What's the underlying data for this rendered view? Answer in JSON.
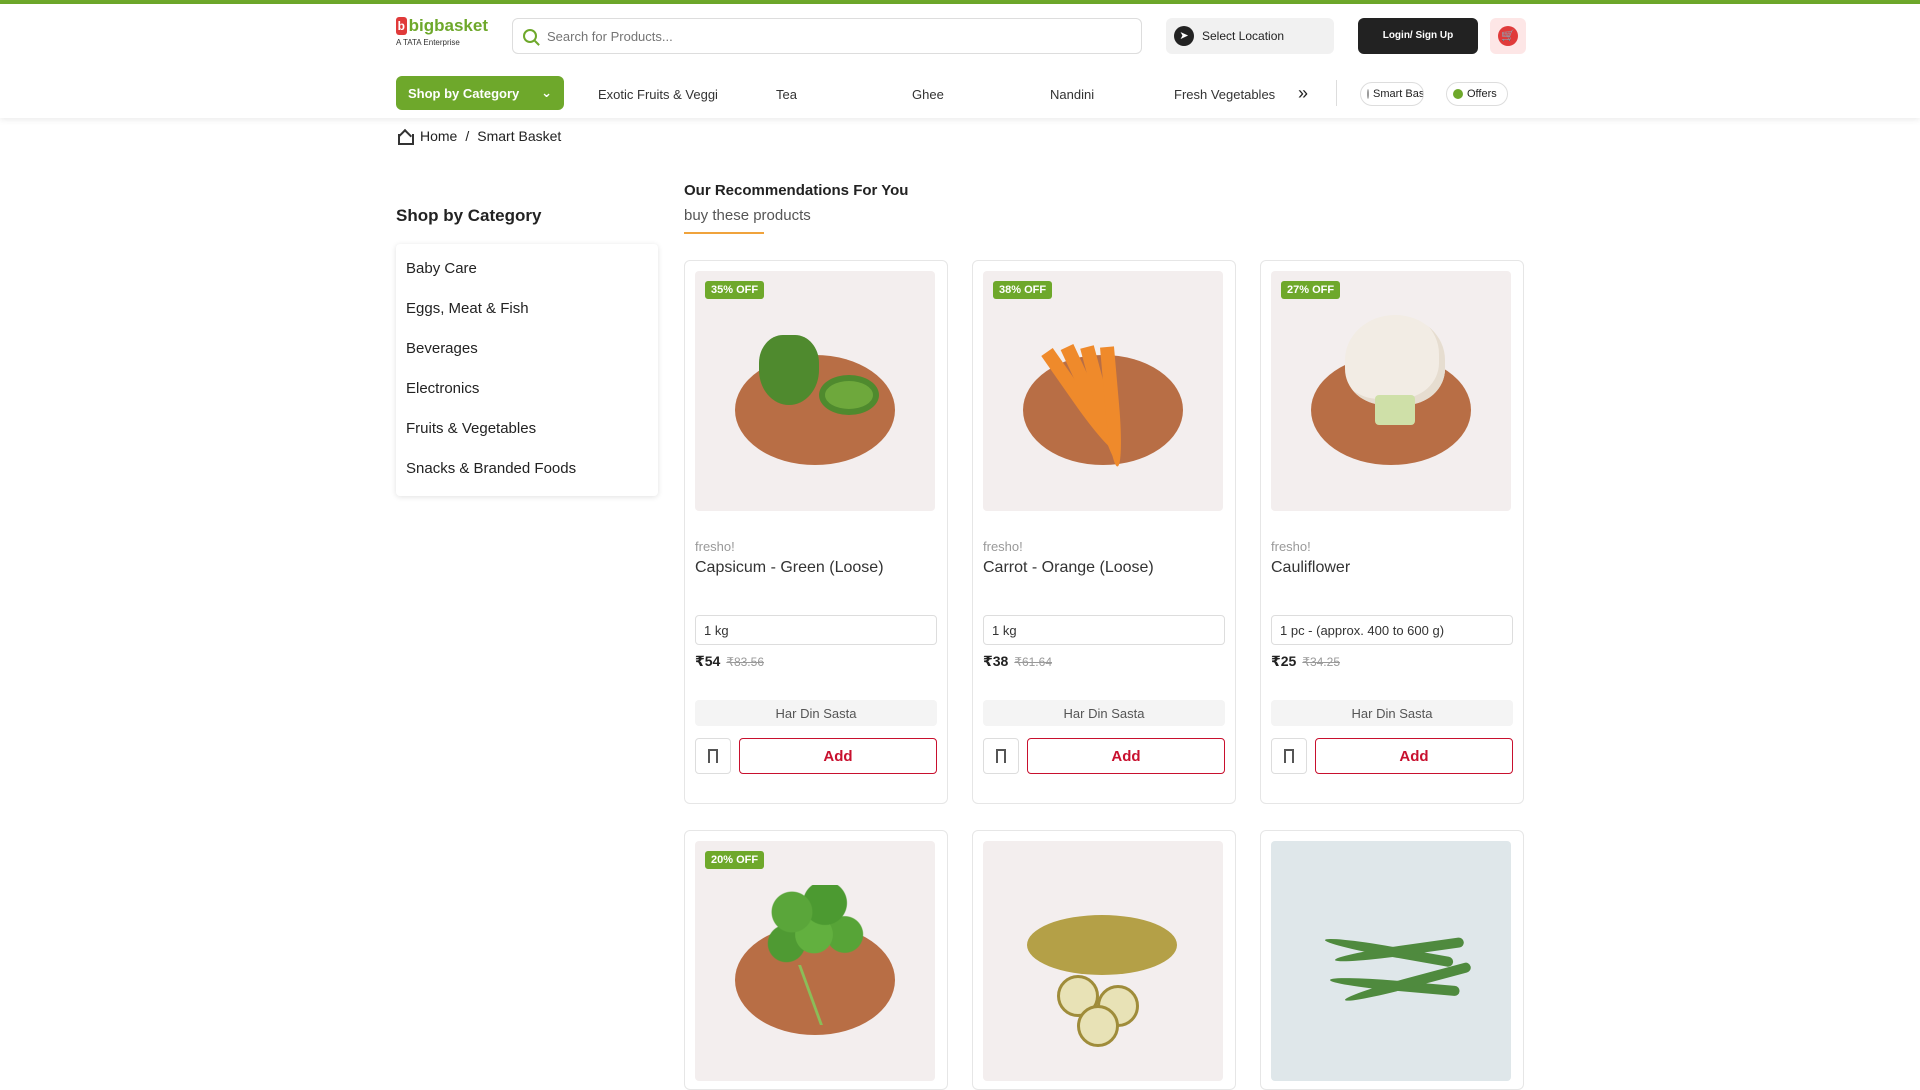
{
  "header": {
    "logo_text": "bigbasket",
    "logo_tagline": "A TATA Enterprise",
    "search_placeholder": "Search for Products...",
    "location_label": "Select Location",
    "login_label": "Login/ Sign Up"
  },
  "catnav": {
    "shop_by_category": "Shop by Category",
    "items": [
      "Exotic Fruits & Veggies",
      "Tea",
      "Ghee",
      "Nandini",
      "Fresh Vegetables"
    ],
    "chips": [
      "Smart Basket",
      "Offers"
    ]
  },
  "breadcrumb": {
    "home": "Home",
    "current": "Smart Basket"
  },
  "sidebar": {
    "title": "Shop by Category",
    "items": [
      "Baby Care",
      "Eggs, Meat & Fish",
      "Beverages",
      "Electronics",
      "Fruits & Vegetables",
      "Snacks & Branded Foods"
    ]
  },
  "recommendations": {
    "title": "Our Recommendations For You",
    "subtitle": "buy these products"
  },
  "products": [
    {
      "discount": "35% OFF",
      "brand": "fresho!",
      "name": "Capsicum - Green (Loose)",
      "qty": "1 kg",
      "price": "₹54",
      "mrp": "₹83.56",
      "tag": "Har Din Sasta",
      "add": "Add"
    },
    {
      "discount": "38% OFF",
      "brand": "fresho!",
      "name": "Carrot - Orange (Loose)",
      "qty": "1 kg",
      "price": "₹38",
      "mrp": "₹61.64",
      "tag": "Har Din Sasta",
      "add": "Add"
    },
    {
      "discount": "27% OFF",
      "brand": "fresho!",
      "name": "Cauliflower",
      "qty": "1 pc - (approx. 400 to 600 g)",
      "price": "₹25",
      "mrp": "₹34.25",
      "tag": "Har Din Sasta",
      "add": "Add"
    },
    {
      "discount": "20% OFF"
    },
    {
      "discount": ""
    },
    {
      "discount": ""
    }
  ],
  "colors": {
    "brand_green": "#6ea82b",
    "add_red": "#c8102e"
  }
}
